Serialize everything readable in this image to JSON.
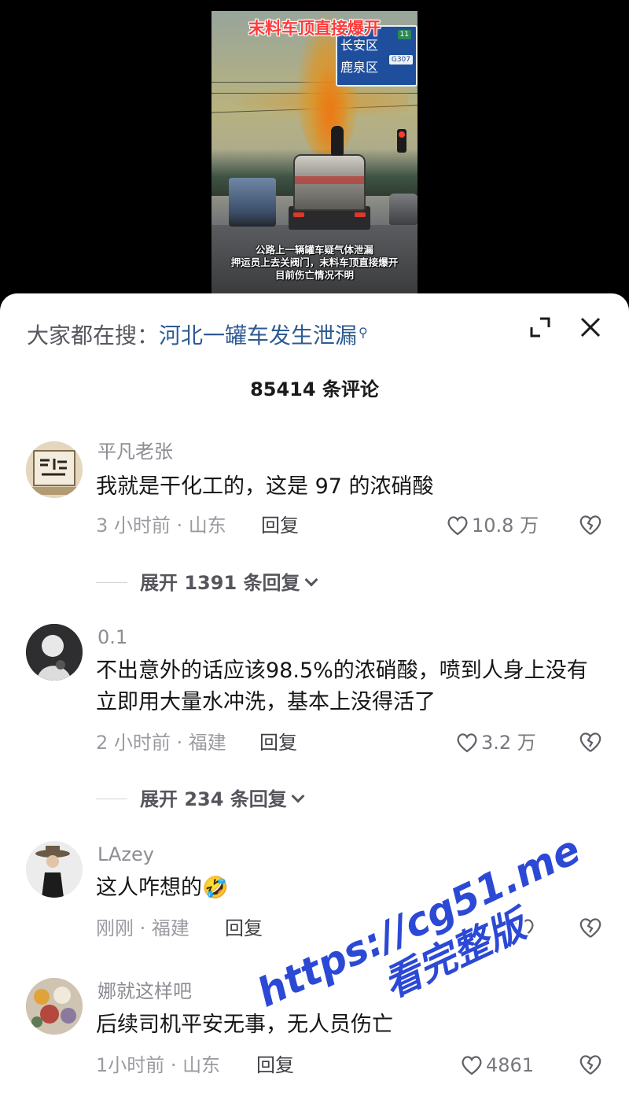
{
  "video": {
    "title": "末料车顶直接爆开",
    "sign": {
      "line1": "长安区",
      "line2": "鹿泉区",
      "route": "G307",
      "num": "11"
    },
    "caption_lines": [
      "公路上一辆罐车疑气体泄漏",
      "押运员上去关阀门，末料车顶直接爆开",
      "目前伤亡情况不明"
    ]
  },
  "search": {
    "prefix": "大家都在搜：",
    "term": "河北一罐车发生泄漏",
    "icon": "search-icon"
  },
  "header": {
    "comment_count": "85414 条评论"
  },
  "comments": [
    {
      "username": "平凡老张",
      "text": "我就是干化工的，这是 97 的浓硝酸",
      "time_location": "3 小时前 · 山东",
      "reply_label": "回复",
      "likes": "10.8 万",
      "expand": "展开 1391 条回复"
    },
    {
      "username": "0.1",
      "text": "不出意外的话应该98.5%的浓硝酸，喷到人身上没有立即用大量水冲洗，基本上没得活了",
      "time_location": "2 小时前 · 福建",
      "reply_label": "回复",
      "likes": "3.2 万",
      "expand": "展开 234 条回复"
    },
    {
      "username": "LAzey",
      "text": "这人咋想的",
      "emoji": "🤣",
      "time_location": "刚刚 · 福建",
      "reply_label": "回复",
      "likes": ""
    },
    {
      "username": "娜就这样吧",
      "text": "后续司机平安无事，无人员伤亡",
      "time_location": "1小时前 · 山东",
      "reply_label": "回复",
      "likes": "4861"
    }
  ],
  "watermark": {
    "url": "https://cg51.me",
    "subtitle": "看完整版"
  },
  "colors": {
    "search_link": "#2f5a93",
    "watermark": "#2c49d6",
    "title_red": "#ff3b3b"
  }
}
